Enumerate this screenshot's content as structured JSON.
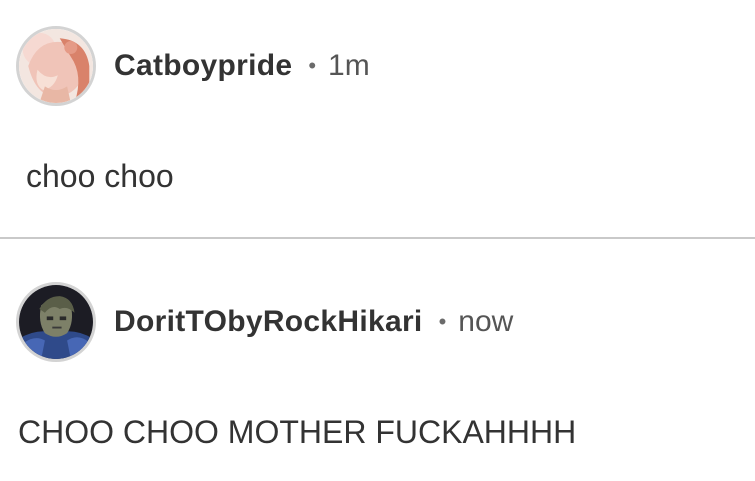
{
  "comments": [
    {
      "username": "Catboypride",
      "separator": "•",
      "time": "1m",
      "text": "choo choo",
      "avatar_icon": "anime-avatar-pink-icon"
    },
    {
      "username": "DoritTObyRockHikari",
      "separator": "•",
      "time": "now",
      "text": "CHOO CHOO MOTHER FUCKAHHHH",
      "avatar_icon": "anime-avatar-dark-icon"
    }
  ],
  "colors": {
    "divider": "#c9c9c9",
    "avatar_border": "#d3d3d3",
    "text": "#333333"
  }
}
